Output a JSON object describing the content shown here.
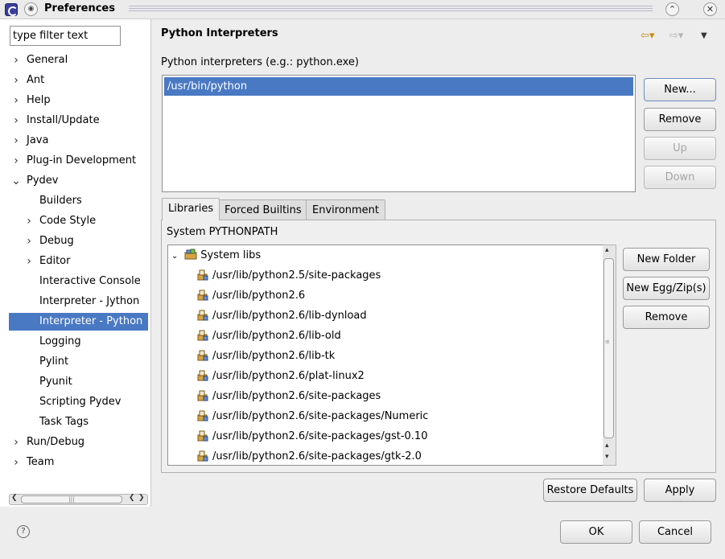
{
  "window": {
    "title": "Preferences",
    "menu_glyph": "◉",
    "minimize_glyph": "⌃",
    "close_glyph": "✕"
  },
  "filter": {
    "placeholder": "type filter text",
    "value": "type filter text"
  },
  "tree": {
    "items": [
      {
        "label": "General",
        "level": 0,
        "expander": "›"
      },
      {
        "label": "Ant",
        "level": 0,
        "expander": "›"
      },
      {
        "label": "Help",
        "level": 0,
        "expander": "›"
      },
      {
        "label": "Install/Update",
        "level": 0,
        "expander": "›"
      },
      {
        "label": "Java",
        "level": 0,
        "expander": "›"
      },
      {
        "label": "Plug-in Development",
        "level": 0,
        "expander": "›"
      },
      {
        "label": "Pydev",
        "level": 0,
        "expander": "⌄"
      },
      {
        "label": "Builders",
        "level": 1,
        "expander": ""
      },
      {
        "label": "Code Style",
        "level": 1,
        "expander": "›"
      },
      {
        "label": "Debug",
        "level": 1,
        "expander": "›"
      },
      {
        "label": "Editor",
        "level": 1,
        "expander": "›"
      },
      {
        "label": "Interactive Console",
        "level": 1,
        "expander": ""
      },
      {
        "label": "Interpreter - Jython",
        "level": 1,
        "expander": ""
      },
      {
        "label": "Interpreter - Python",
        "level": 1,
        "expander": "",
        "selected": true
      },
      {
        "label": "Logging",
        "level": 1,
        "expander": ""
      },
      {
        "label": "Pylint",
        "level": 1,
        "expander": ""
      },
      {
        "label": "Pyunit",
        "level": 1,
        "expander": ""
      },
      {
        "label": "Scripting Pydev",
        "level": 1,
        "expander": ""
      },
      {
        "label": "Task Tags",
        "level": 1,
        "expander": ""
      },
      {
        "label": "Run/Debug",
        "level": 0,
        "expander": "›"
      },
      {
        "label": "Team",
        "level": 0,
        "expander": "›"
      }
    ]
  },
  "page": {
    "title": "Python Interpreters",
    "back_glyph": "⇦▾",
    "forward_glyph": "⇨▾",
    "menu_glyph": "▼",
    "interpreters_label": "Python interpreters (e.g.: python.exe)",
    "interpreters": [
      "/usr/bin/python"
    ],
    "buttons": {
      "new": "New...",
      "remove": "Remove",
      "up": "Up",
      "down": "Down"
    },
    "tabs": [
      "Libraries",
      "Forced Builtins",
      "Environment"
    ],
    "pythonpath_label": "System PYTHONPATH",
    "libs_root": "System libs",
    "libs": [
      "/usr/lib/python2.5/site-packages",
      "/usr/lib/python2.6",
      "/usr/lib/python2.6/lib-dynload",
      "/usr/lib/python2.6/lib-old",
      "/usr/lib/python2.6/lib-tk",
      "/usr/lib/python2.6/plat-linux2",
      "/usr/lib/python2.6/site-packages",
      "/usr/lib/python2.6/site-packages/Numeric",
      "/usr/lib/python2.6/site-packages/gst-0.10",
      "/usr/lib/python2.6/site-packages/gtk-2.0"
    ],
    "lib_buttons": {
      "new_folder": "New Folder",
      "new_egg": "New Egg/Zip(s)",
      "remove": "Remove"
    },
    "restore_defaults": "Restore Defaults",
    "apply": "Apply"
  },
  "dialog": {
    "help_glyph": "?",
    "ok": "OK",
    "cancel": "Cancel"
  },
  "colors": {
    "selection": "#4a79c4",
    "accent_arrow": "#c98c10"
  }
}
